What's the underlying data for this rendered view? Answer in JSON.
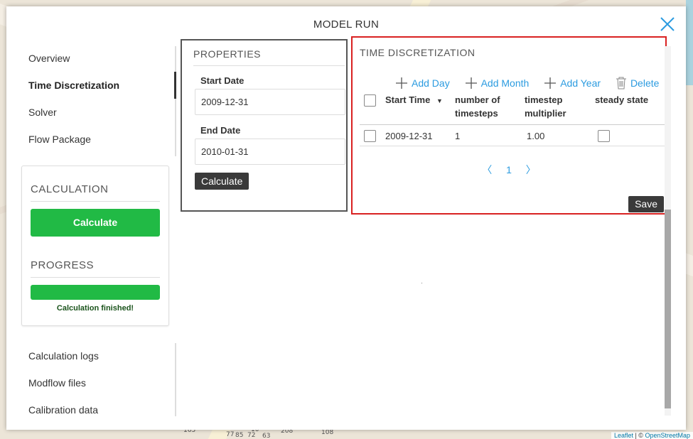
{
  "map": {
    "attribution_leaflet": "Leaflet",
    "attribution_sep": " | © ",
    "attribution_osm": "OpenStreetMap",
    "labels": [
      "165",
      "85",
      "72",
      "63",
      "208",
      "108",
      "10",
      "77"
    ]
  },
  "modal": {
    "title": "MODEL RUN",
    "close_icon": "close-icon"
  },
  "menu": {
    "items": [
      {
        "label": "Overview"
      },
      {
        "label": "Time Discretization"
      },
      {
        "label": "Solver"
      },
      {
        "label": "Flow Package"
      }
    ],
    "active_index": 1,
    "lower_items": [
      {
        "label": "Calculation logs"
      },
      {
        "label": "Modflow files"
      },
      {
        "label": "Calibration data"
      }
    ]
  },
  "calculation": {
    "heading": "CALCULATION",
    "button_label": "Calculate",
    "progress_heading": "PROGRESS",
    "progress_percent": 100,
    "status_text": "Calculation finished!",
    "color": "#21ba45"
  },
  "properties": {
    "title": "PROPERTIES",
    "start_date_label": "Start Date",
    "start_date_value": "2009-12-31",
    "end_date_label": "End Date",
    "end_date_value": "2010-01-31",
    "calculate_label": "Calculate"
  },
  "time_discretization": {
    "title": "TIME DISCRETIZATION",
    "toolbar": {
      "add_day": "Add Day",
      "add_month": "Add Month",
      "add_year": "Add Year",
      "delete": "Delete"
    },
    "columns": {
      "start_time": "Start Time",
      "number_of_timesteps": [
        "number of",
        "timesteps"
      ],
      "timestep_multiplier": [
        "timestep",
        "multiplier"
      ],
      "steady_state": "steady state"
    },
    "rows": [
      {
        "start_time": "2009-12-31",
        "timesteps": "1",
        "multiplier": "1.00",
        "steady": false
      }
    ],
    "pager": {
      "prev": "〈",
      "page": "1",
      "next": "〉"
    },
    "save_label": "Save",
    "highlight_color": "#d92121"
  }
}
